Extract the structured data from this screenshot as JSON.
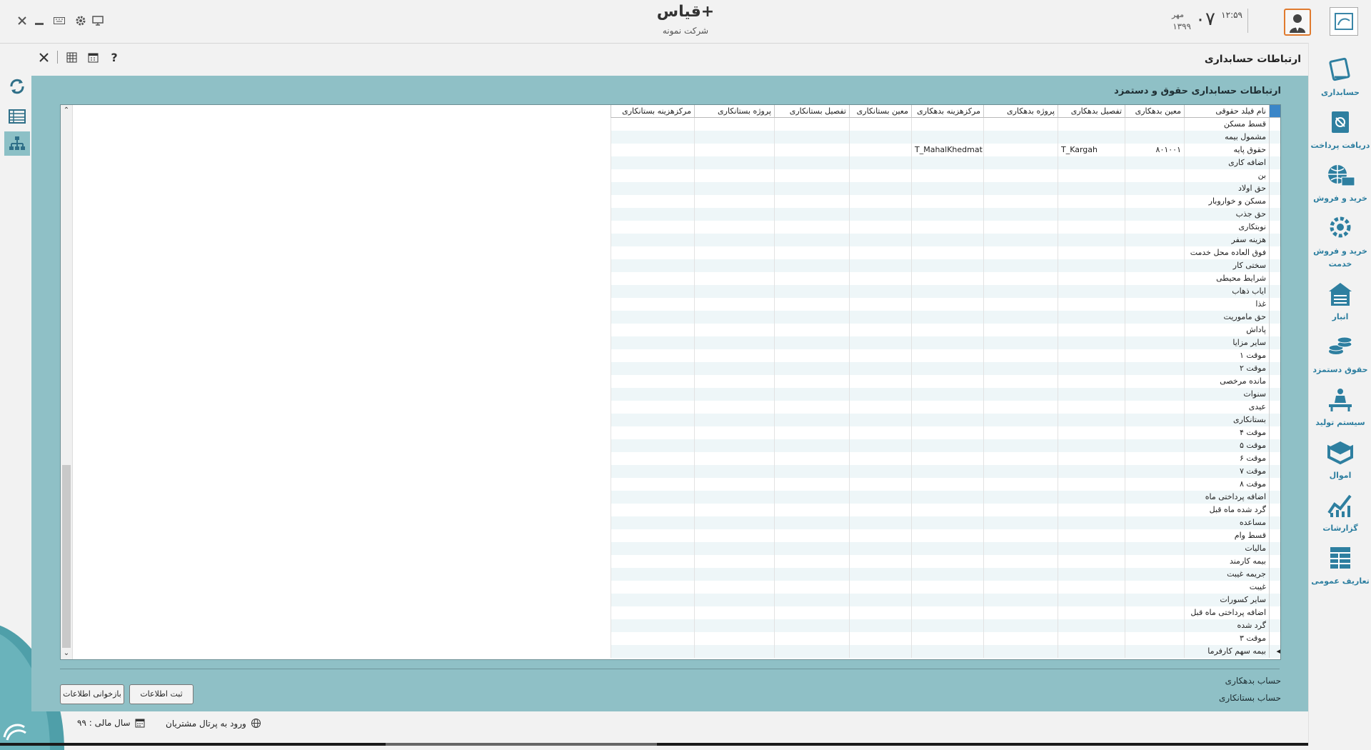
{
  "app": {
    "title": "قیاس+",
    "company": "شرکت نمونه",
    "clock": {
      "time": "۱۲:۵۹",
      "day": "۰۷",
      "month": "مهر",
      "year": "۱۳۹۹"
    }
  },
  "page": {
    "title": "ارتباطات حسابداری"
  },
  "section": {
    "title": "ارتباطات حسابداری حقوق و دستمزد"
  },
  "grid": {
    "columns": [
      "نام فیلد حقوقی",
      "معین بدهکاری",
      "تفصیل بدهکاری",
      "پروژه بدهکاری",
      "مرکزهزینه بدهکاری",
      "معین بستانکاری",
      "تفصیل بستانکاری",
      "پروژه بستانکاری",
      "مرکزهزینه بستانکاری"
    ],
    "rows": [
      [
        "قسط مسکن",
        "",
        "",
        "",
        "",
        "",
        "",
        "",
        ""
      ],
      [
        "مشمول بیمه",
        "",
        "",
        "",
        "",
        "",
        "",
        "",
        ""
      ],
      [
        "حقوق پایه",
        "۸۰۱۰۰۱",
        "T_Kargah",
        "",
        "T_MahalKhedmat",
        "",
        "",
        "",
        ""
      ],
      [
        "اضافه کاری",
        "",
        "",
        "",
        "",
        "",
        "",
        "",
        ""
      ],
      [
        "بن",
        "",
        "",
        "",
        "",
        "",
        "",
        "",
        ""
      ],
      [
        "حق اولاد",
        "",
        "",
        "",
        "",
        "",
        "",
        "",
        ""
      ],
      [
        "مسکن و خواروبار",
        "",
        "",
        "",
        "",
        "",
        "",
        "",
        ""
      ],
      [
        "حق جذب",
        "",
        "",
        "",
        "",
        "",
        "",
        "",
        ""
      ],
      [
        "نوبتکاری",
        "",
        "",
        "",
        "",
        "",
        "",
        "",
        ""
      ],
      [
        "هزینه سفر",
        "",
        "",
        "",
        "",
        "",
        "",
        "",
        ""
      ],
      [
        "فوق العاده محل خدمت",
        "",
        "",
        "",
        "",
        "",
        "",
        "",
        ""
      ],
      [
        "سختی کار",
        "",
        "",
        "",
        "",
        "",
        "",
        "",
        ""
      ],
      [
        "شرایط محیطی",
        "",
        "",
        "",
        "",
        "",
        "",
        "",
        ""
      ],
      [
        "ایاب ذهاب",
        "",
        "",
        "",
        "",
        "",
        "",
        "",
        ""
      ],
      [
        "غذا",
        "",
        "",
        "",
        "",
        "",
        "",
        "",
        ""
      ],
      [
        "حق ماموریت",
        "",
        "",
        "",
        "",
        "",
        "",
        "",
        ""
      ],
      [
        "پاداش",
        "",
        "",
        "",
        "",
        "",
        "",
        "",
        ""
      ],
      [
        "سایر مزایا",
        "",
        "",
        "",
        "",
        "",
        "",
        "",
        ""
      ],
      [
        "موقت ۱",
        "",
        "",
        "",
        "",
        "",
        "",
        "",
        ""
      ],
      [
        "موقت ۲",
        "",
        "",
        "",
        "",
        "",
        "",
        "",
        ""
      ],
      [
        "مانده مرخصی",
        "",
        "",
        "",
        "",
        "",
        "",
        "",
        ""
      ],
      [
        "سنوات",
        "",
        "",
        "",
        "",
        "",
        "",
        "",
        ""
      ],
      [
        "عیدی",
        "",
        "",
        "",
        "",
        "",
        "",
        "",
        ""
      ],
      [
        "بستانکاری",
        "",
        "",
        "",
        "",
        "",
        "",
        "",
        ""
      ],
      [
        "موقت ۴",
        "",
        "",
        "",
        "",
        "",
        "",
        "",
        ""
      ],
      [
        "موقت ۵",
        "",
        "",
        "",
        "",
        "",
        "",
        "",
        ""
      ],
      [
        "موقت ۶",
        "",
        "",
        "",
        "",
        "",
        "",
        "",
        ""
      ],
      [
        "موقت ۷",
        "",
        "",
        "",
        "",
        "",
        "",
        "",
        ""
      ],
      [
        "موقت ۸",
        "",
        "",
        "",
        "",
        "",
        "",
        "",
        ""
      ],
      [
        "اضافه پرداختی ماه",
        "",
        "",
        "",
        "",
        "",
        "",
        "",
        ""
      ],
      [
        "گرد شده ماه قبل",
        "",
        "",
        "",
        "",
        "",
        "",
        "",
        ""
      ],
      [
        "مساعده",
        "",
        "",
        "",
        "",
        "",
        "",
        "",
        ""
      ],
      [
        "قسط وام",
        "",
        "",
        "",
        "",
        "",
        "",
        "",
        ""
      ],
      [
        "مالیات",
        "",
        "",
        "",
        "",
        "",
        "",
        "",
        ""
      ],
      [
        "بیمه کارمند",
        "",
        "",
        "",
        "",
        "",
        "",
        "",
        ""
      ],
      [
        "جریمه غیبت",
        "",
        "",
        "",
        "",
        "",
        "",
        "",
        ""
      ],
      [
        "غیبت",
        "",
        "",
        "",
        "",
        "",
        "",
        "",
        ""
      ],
      [
        "سایر کسورات",
        "",
        "",
        "",
        "",
        "",
        "",
        "",
        ""
      ],
      [
        "اضافه پرداختی ماه قبل",
        "",
        "",
        "",
        "",
        "",
        "",
        "",
        ""
      ],
      [
        "گرد شده",
        "",
        "",
        "",
        "",
        "",
        "",
        "",
        ""
      ],
      [
        "موقت ۳",
        "",
        "",
        "",
        "",
        "",
        "",
        "",
        ""
      ],
      [
        "بیمه سهم کارفرما",
        "",
        "",
        "",
        "",
        "",
        "",
        "",
        ""
      ]
    ]
  },
  "footer": {
    "debit_label": "حساب بدهکاری",
    "credit_label": "حساب بستانکاری",
    "save_button": "ثبت اطلاعات",
    "reload_button": "بازخوانی اطلاعات"
  },
  "status": {
    "fiscal_year": "سال مالی : ۹۹",
    "portal": "ورود به پرتال مشتریان"
  },
  "sidebar": {
    "items": [
      {
        "label": "حسابداری",
        "icon": "accounting-icon"
      },
      {
        "label": "دریافت پرداخت",
        "icon": "payment-icon"
      },
      {
        "label": "خرید و فروش",
        "icon": "sales-icon"
      },
      {
        "label": "خرید و فروش خدمت",
        "icon": "service-icon"
      },
      {
        "label": "انبار",
        "icon": "warehouse-icon"
      },
      {
        "label": "حقوق دستمزد",
        "icon": "payroll-icon"
      },
      {
        "label": "سیستم تولید",
        "icon": "production-icon"
      },
      {
        "label": "اموال",
        "icon": "assets-icon"
      },
      {
        "label": "گزارشات",
        "icon": "reports-icon"
      },
      {
        "label": "تعاریف عمومی",
        "icon": "definitions-icon"
      }
    ]
  },
  "colors": {
    "panel": "#8fc0c6",
    "accent": "#2e7fa0",
    "avatar_border": "#e07a2e"
  }
}
